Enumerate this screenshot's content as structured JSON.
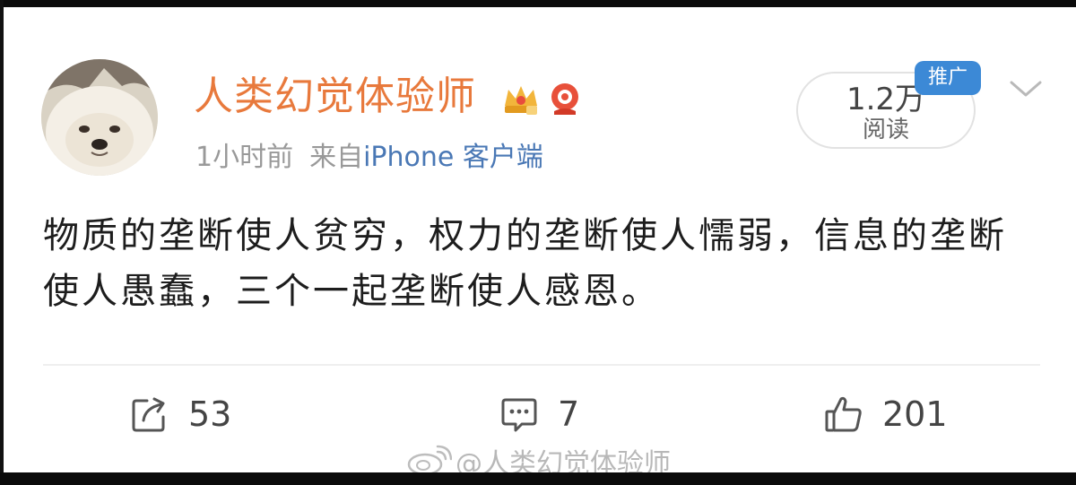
{
  "post": {
    "username": "人类幻觉体验师",
    "time": "1小时前",
    "source_prefix": "来自",
    "source_name": "iPhone 客户端",
    "read_count": "1.2万",
    "read_label": "阅读",
    "promo_tag": "推广",
    "text": "物质的垄断使人贫穷，权力的垄断使人懦弱，信息的垄断使人愚蠢，三个一起垄断使人感恩。"
  },
  "actions": {
    "repost_count": "53",
    "comment_count": "7",
    "like_count": "201"
  },
  "watermark": {
    "text": "@人类幻觉体验师"
  },
  "icons": {
    "avatar": "dog-avatar",
    "badges": [
      "crown-badge-icon",
      "hat-badge-icon"
    ],
    "chevron": "chevron-down-icon",
    "repost": "repost-icon",
    "comment": "comment-icon",
    "like": "thumbs-up-icon",
    "watermark_logo": "weibo-logo-icon"
  },
  "colors": {
    "username": "#e8793c",
    "source": "#4a78b5",
    "promo_tag": "#3c89d6",
    "meta": "#999999"
  }
}
